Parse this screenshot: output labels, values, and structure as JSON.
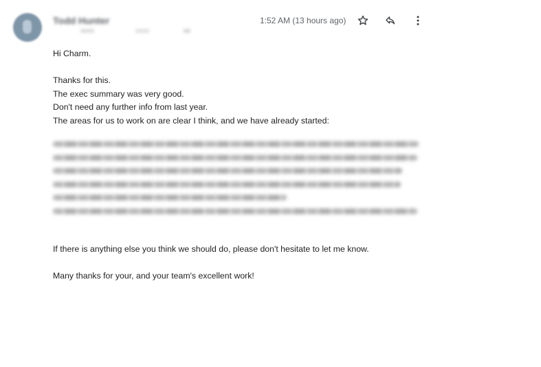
{
  "header": {
    "sender_name": "Todd Hunter",
    "timestamp": "1:52 AM (13 hours ago)"
  },
  "icons": {
    "star": "star-icon",
    "reply": "reply-icon",
    "more": "more-vert-icon"
  },
  "message": {
    "greeting": "Hi Charm.",
    "lines": [
      "Thanks for this.",
      "The exec summary was very good.",
      "Don't need any further info from last year.",
      "The areas for us to work on are clear I think, and we have already started:"
    ],
    "closing_1": "If there is anything else you think we should do, please don't hesitate to let me know.",
    "closing_2": "Many thanks for your, and your team's excellent work!"
  }
}
